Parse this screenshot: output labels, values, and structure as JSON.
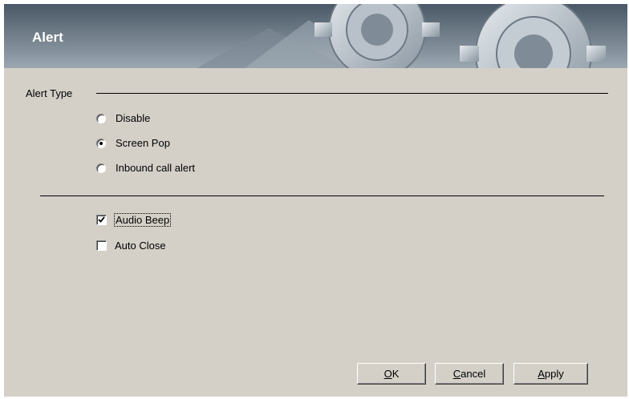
{
  "banner": {
    "title": "Alert",
    "art": "gears-graphic"
  },
  "alert_type": {
    "label": "Alert Type",
    "options": [
      {
        "label": "Disable",
        "selected": false
      },
      {
        "label": "Screen Pop",
        "selected": true
      },
      {
        "label": "Inbound call alert",
        "selected": false
      }
    ]
  },
  "checkboxes": [
    {
      "label": "Audio Beep",
      "checked": true
    },
    {
      "label": "Auto Close",
      "checked": false
    }
  ],
  "buttons": {
    "ok": {
      "mnemonic": "O",
      "rest": "K"
    },
    "cancel": {
      "mnemonic": "C",
      "rest": "ancel"
    },
    "apply": {
      "mnemonic": "A",
      "rest": "pply"
    }
  },
  "colors": {
    "dialog_bg": "#d4d0c8",
    "banner_dark": "#4a5866",
    "banner_light": "#9aa6b0"
  }
}
